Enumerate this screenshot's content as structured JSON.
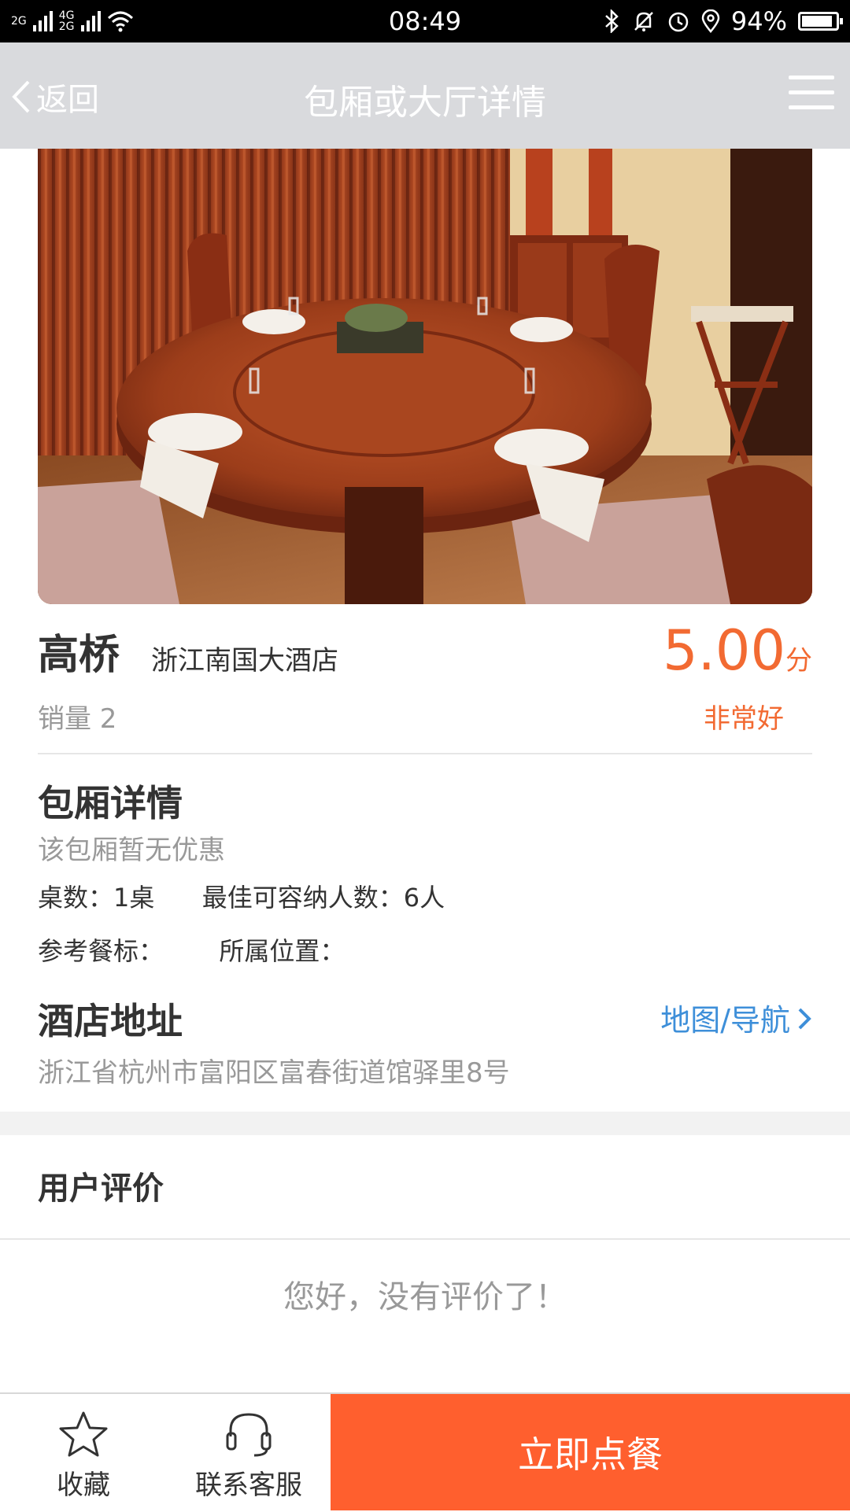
{
  "status_bar": {
    "network_top": "2G",
    "network_mid": "4G",
    "network_bottom": "2G",
    "time": "08:49",
    "battery_percent_text": "94%",
    "battery_level": 0.94
  },
  "nav": {
    "back_label": "返回",
    "title": "包厢或大厅详情"
  },
  "room": {
    "name": "高桥",
    "hotel": "浙江南国大酒店",
    "score": "5.00",
    "score_unit": "分",
    "rating_text": "非常好",
    "sales": "销量 2"
  },
  "details": {
    "title": "包厢详情",
    "promo": "该包厢暂无优惠",
    "tables": "桌数：1桌",
    "capacity": "最佳可容纳人数：6人",
    "ref_price": "参考餐标：",
    "location": "所属位置："
  },
  "address": {
    "title": "酒店地址",
    "map_link": "地图/导航",
    "text": "浙江省杭州市富阳区富春街道馆驿里8号"
  },
  "reviews": {
    "title": "用户评价",
    "empty_text": "您好，没有评价了！"
  },
  "bottom": {
    "favorite_label": "收藏",
    "service_label": "联系客服",
    "order_label": "立即点餐"
  },
  "colors": {
    "accent": "#ff5f2e",
    "score": "#f26a32",
    "link": "#3e8fd9",
    "nav_bg": "#d9dadd"
  }
}
